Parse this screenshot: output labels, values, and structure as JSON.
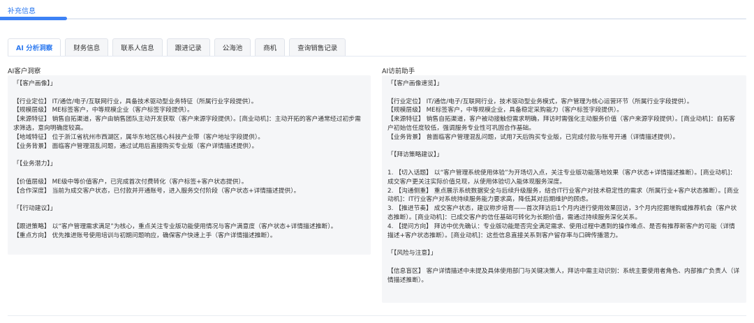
{
  "header": {
    "title": "补充信息"
  },
  "tabs": [
    {
      "label": "AI 分析洞察",
      "active": true
    },
    {
      "label": "财务信息",
      "active": false
    },
    {
      "label": "联系人信息",
      "active": false
    },
    {
      "label": "跟进记录",
      "active": false
    },
    {
      "label": "公海池",
      "active": false
    },
    {
      "label": "商机",
      "active": false
    },
    {
      "label": "查询销售记录",
      "active": false
    }
  ],
  "left_panel": {
    "label": "AI客户洞察",
    "lines": [
      "「【客户画像】」",
      "",
      "【行业定位】 IT/通信/电子/互联网行业，具备技术驱动型业务特征（所属行业字段提供）。",
      "【规模层级】 ME标签客户，中等规模企业（客户标签字段提供）。",
      "【来源特征】 销售自拓渠道，客户由销售团队主动开发获取（客户来源字段提供）。[商业动机]：主动开拓的客户通常经过初步需求筛选，意向明确度较高。",
      "【地域特征】 位于浙江省杭州市西湖区，属华东地区核心科技产业带（客户地址字段提供）。",
      "【业务背景】 面临客户管理混乱问题，通过试用后直接购买专业版（客户详情描述提供）。",
      "",
      "「【业务潜力】」",
      "",
      "【价值层级】 ME级中等价值客户，已完成首次付费转化（客户标签+客户状态提供）。",
      "【合作深度】 当前为成交客户状态，已付款并开通账号，进入服务交付阶段（客户状态+详情描述提供）。",
      "",
      "「【行动建议】」",
      "",
      "【跟进策略】 以“客户管理需求满足”为核心，重点关注专业版功能使用情况与客户满意度（客户状态+详情描述推断）。",
      "【重点方向】 优先推进账号使用培训与初期问题响应，确保客户快速上手（客户详情描述推断）。"
    ]
  },
  "right_panel": {
    "label": "AI访前助手",
    "lines": [
      "「【客户画像速览】」",
      "",
      "【行业定位】 IT/通信/电子/互联网行业，技术驱动型业务模式，客户管理为核心运营环节（所属行业字段提供）。",
      "【规模层级】 ME标签客户，中等规模企业，具备稳定采购能力（客户标签字段提供）。",
      "【来源特征】 销售自拓渠道，客户被动接触但需求明确，拜访时需强化主动服务价值（客户来源字段提供）。[商业动机]：自拓客户初始信任度较低，强调服务专业性可巩固合作基础。",
      "【业务背景】 曾面临客户管理混乱问题，试用7天后购买专业版，已完成付款与账号开通（详情描述提供）。",
      "",
      "「【拜访策略建议】」",
      "",
      "1. 【切入话题】 以“客户管理系统使用体验”为开场切入点，关注专业版功能落地效果（客户状态+详情描述推断）。[商业动机]：成交客户更关注实际价值兑现，从使用体验切入能体现服务深度。",
      "2. 【沟通侧重】 重点展示系统数据安全与后续升级服务，结合IT行业客户对技术稳定性的需求（所属行业+客户状态推断）。[商业动机]：IT行业客户对系统持续服务能力要求高，降低其对后期维护的顾虑。",
      "3. 【推进节奏】 成交客户状态，建议称步培育——首次拜访后1个月内进行使用效果回访，3个月内挖掘增购或推荐机会（客户状态推断）。[商业动机]：已成交客户的信任基础可转化为长期价值，需通过持续服务深化关系。",
      "4. 【提问方向】 拜访中优先确认：专业版功能是否完全满足需求、使用过程中遇到的操作难点、是否有推荐新客户的可能（详情描述+客户状态推断）。[商业动机]：这些信息直接关系到客户留存率与口碑传播潜力。",
      "",
      "「【风险与注意】」",
      "",
      "【信息盲区】 客户详情描述中未提及具体使用部门与关键决策人，拜访中需主动识别：系统主要使用者角色、内部推广负责人（详情描述推断）。"
    ]
  }
}
